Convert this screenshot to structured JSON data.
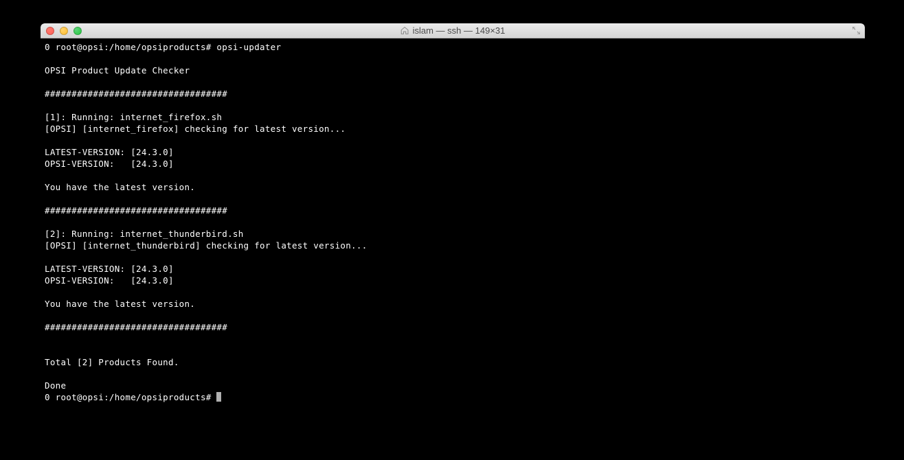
{
  "window": {
    "title": "islam — ssh — 149×31"
  },
  "terminal": {
    "line01": "0 root@opsi:/home/opsiproducts# opsi-updater",
    "line02": "",
    "line03": "OPSI Product Update Checker",
    "line04": "",
    "line05": "##################################",
    "line06": "",
    "line07": "[1]: Running: internet_firefox.sh",
    "line08": "[OPSI] [internet_firefox] checking for latest version...",
    "line09": "",
    "line10": "LATEST-VERSION: [24.3.0]",
    "line11": "OPSI-VERSION:   [24.3.0]",
    "line12": "",
    "line13": "You have the latest version.",
    "line14": "",
    "line15": "##################################",
    "line16": "",
    "line17": "[2]: Running: internet_thunderbird.sh",
    "line18": "[OPSI] [internet_thunderbird] checking for latest version...",
    "line19": "",
    "line20": "LATEST-VERSION: [24.3.0]",
    "line21": "OPSI-VERSION:   [24.3.0]",
    "line22": "",
    "line23": "You have the latest version.",
    "line24": "",
    "line25": "##################################",
    "line26": "",
    "line27": "",
    "line28": "Total [2] Products Found.",
    "line29": "",
    "line30": "Done",
    "line31": "0 root@opsi:/home/opsiproducts# "
  }
}
